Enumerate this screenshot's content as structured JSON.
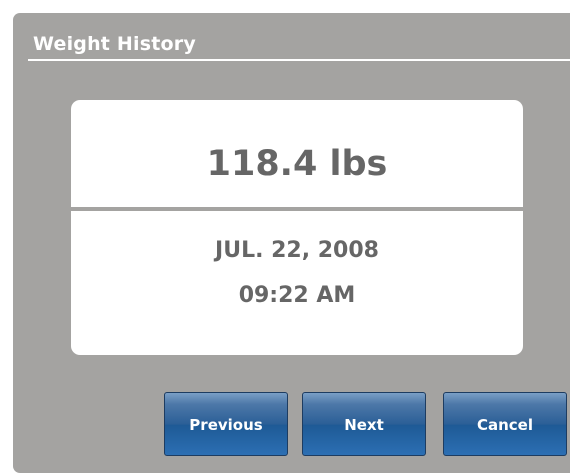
{
  "window": {
    "title": "Weight History"
  },
  "record": {
    "weight": "118.4 lbs",
    "date": "JUL. 22, 2008",
    "time": "09:22 AM"
  },
  "buttons": {
    "previous_label": "Previous",
    "next_label": "Next",
    "cancel_label": "Cancel"
  },
  "colors": {
    "panel_background": "#a4a3a1",
    "card_background": "#ffffff",
    "text_gray": "#666666",
    "button_blue": "#2b5f97"
  }
}
